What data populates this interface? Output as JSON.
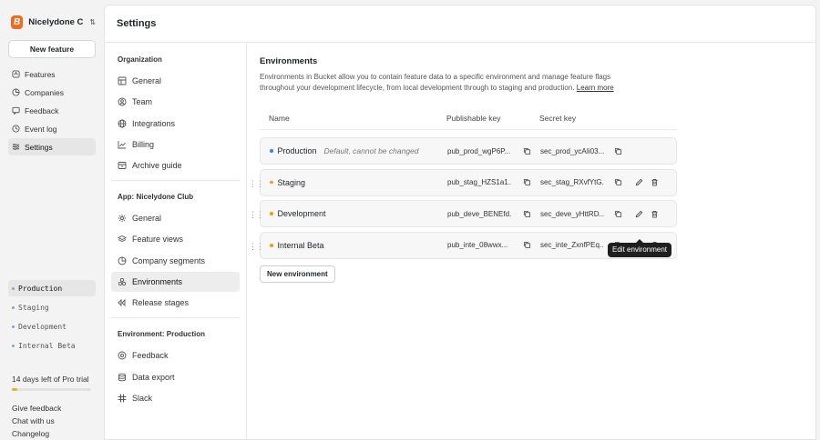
{
  "org": {
    "name": "Nicelydone C...",
    "logo_letter": "B",
    "chevron": "⌃⌄"
  },
  "new_feature_label": "New feature",
  "nav": [
    {
      "label": "Features",
      "icon": "feature-icon",
      "active": false
    },
    {
      "label": "Companies",
      "icon": "company-icon",
      "active": false
    },
    {
      "label": "Feedback",
      "icon": "feedback-icon",
      "active": false
    },
    {
      "label": "Event log",
      "icon": "event-log-icon",
      "active": false
    },
    {
      "label": "Settings",
      "icon": "settings-icon",
      "active": true
    }
  ],
  "environments_switcher": [
    {
      "label": "Production",
      "active": true
    },
    {
      "label": "Staging",
      "active": false
    },
    {
      "label": "Development",
      "active": false
    },
    {
      "label": "Internal Beta",
      "active": false
    }
  ],
  "trial": {
    "text": "14 days left of Pro trial",
    "progress_fraction": 0.07,
    "color": "#f2b01e"
  },
  "footer_links": [
    "Give feedback",
    "Chat with us",
    "Changelog"
  ],
  "page_title": "Settings",
  "settings_nav": {
    "organization": {
      "label": "Organization",
      "items": [
        "General",
        "Team",
        "Integrations",
        "Billing",
        "Archive guide"
      ]
    },
    "app": {
      "label": "App: Nicelydone Club",
      "items": [
        "General",
        "Feature views",
        "Company segments",
        "Environments",
        "Release stages"
      ],
      "active": "Environments"
    },
    "environment": {
      "label": "Environment: Production",
      "items": [
        "Feedback",
        "Data export",
        "Slack"
      ]
    }
  },
  "content": {
    "title": "Environments",
    "description": "Environments in Bucket allow you to contain feature data to a specific environment and manage feature flags throughout your development lifecycle, from local development through to staging and production.",
    "learn_more": "Learn more",
    "columns": {
      "name": "Name",
      "publishable": "Publishable key",
      "secret": "Secret key"
    },
    "rows": [
      {
        "name": "Production",
        "note": "Default, cannot be changed",
        "dot": "#3b82f6",
        "pub": "pub_prod_wgP6P...",
        "sec": "sec_prod_ycAIi03...",
        "editable": false
      },
      {
        "name": "Staging",
        "note": "",
        "dot": "#f59e0b",
        "pub": "pub_stag_HZS1a1...",
        "sec": "sec_stag_RXvfYtG...",
        "editable": true
      },
      {
        "name": "Development",
        "note": "",
        "dot": "#f59e0b",
        "pub": "pub_deve_BENEfd...",
        "sec": "sec_deve_yHttRD...",
        "editable": true
      },
      {
        "name": "Internal Beta",
        "note": "",
        "dot": "#f59e0b",
        "pub": "pub_inte_08wwx...",
        "sec": "sec_inte_ZxnfPEq...",
        "editable": true
      }
    ],
    "new_env_label": "New environment",
    "tooltip": "Edit environment"
  }
}
